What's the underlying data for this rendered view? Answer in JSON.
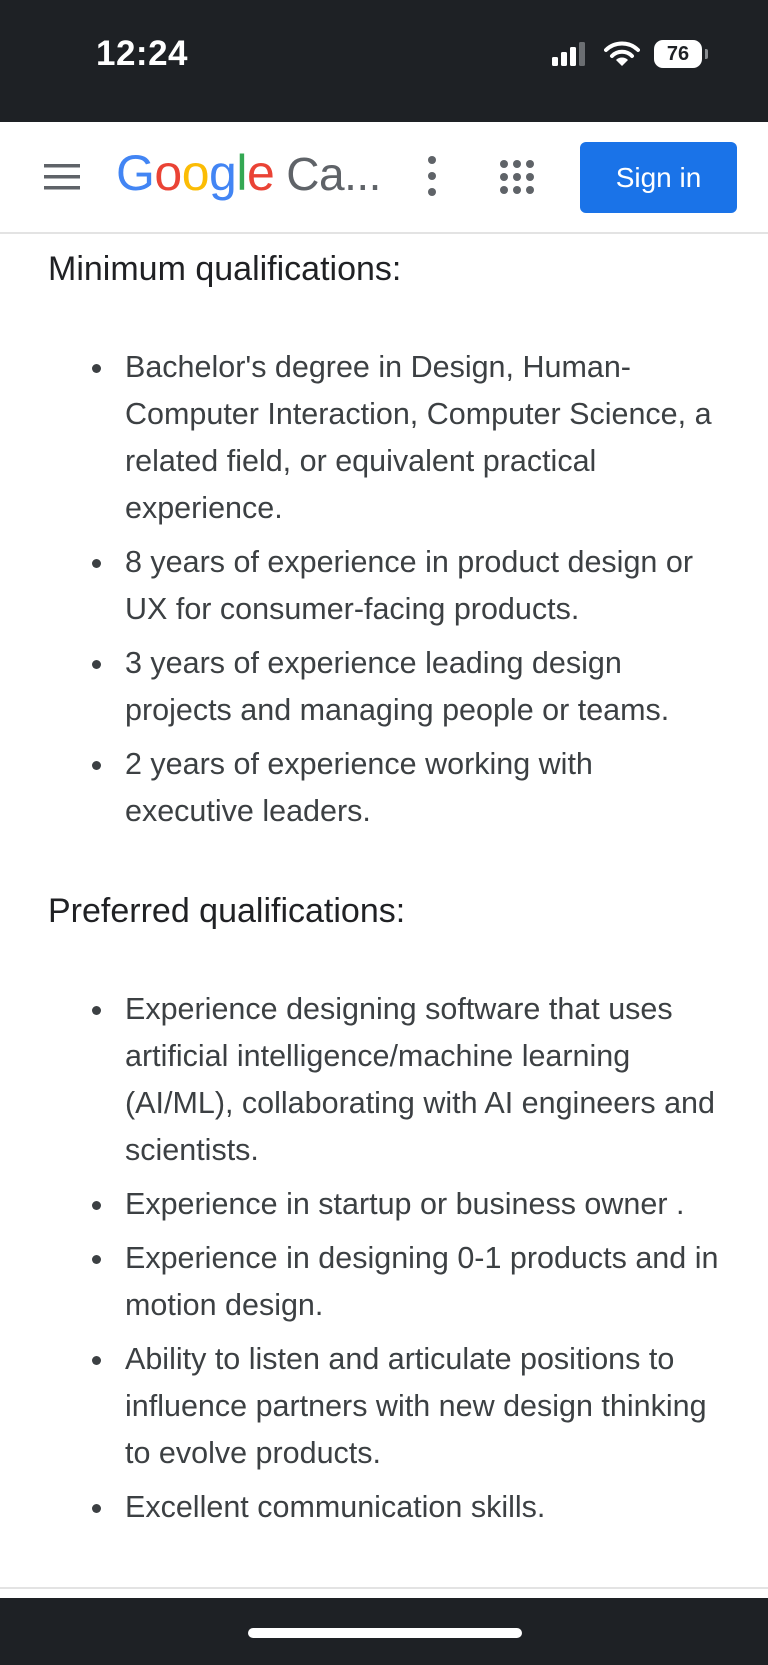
{
  "status_bar": {
    "time": "12:24",
    "battery": "76",
    "icons": [
      "signal-icon",
      "wifi-icon",
      "battery-icon"
    ]
  },
  "header": {
    "logo": {
      "letters": [
        "G",
        "o",
        "o",
        "g",
        "l",
        "e"
      ],
      "product": "Ca..."
    },
    "icons": [
      "menu-icon",
      "more-vert-icon",
      "apps-grid-icon"
    ],
    "signin_label": "Sign in",
    "colors": {
      "signin_background": "#1a73e8",
      "google_blue": "#4285f4",
      "google_red": "#ea4335",
      "google_yellow": "#fbbc05",
      "google_green": "#34a853"
    }
  },
  "minimum": {
    "heading": "Minimum qualifications:",
    "items": [
      "Bachelor's degree in Design, Human-Computer Interaction, Computer Science, a related field, or equivalent practical experience.",
      "8 years of experience in product design or UX for consumer-facing products.",
      "3 years of experience leading design projects and managing people or teams.",
      "2 years of experience working with executive leaders."
    ]
  },
  "preferred": {
    "heading": "Preferred qualifications:",
    "items": [
      "Experience designing software that uses artificial intelligence/machine learning (AI/ML), collaborating with AI engineers and scientists.",
      "Experience in startup or business owner .",
      "Experience in designing 0-1 products and in motion design.",
      "Ability to listen and articulate positions to influence partners with new design thinking to evolve products.",
      "Excellent communication skills."
    ]
  }
}
